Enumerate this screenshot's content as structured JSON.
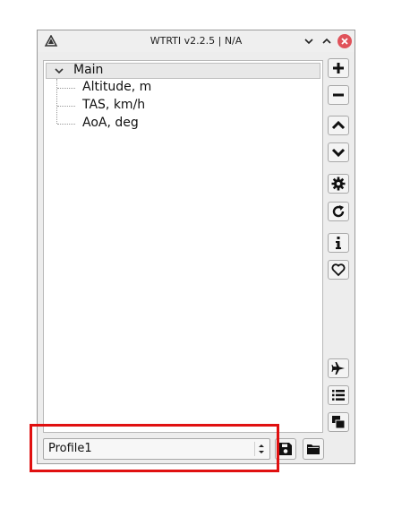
{
  "window": {
    "title": "WTRTI v2.2.5 | N/A",
    "icon": "app-logo-icon"
  },
  "titlebar_buttons": [
    "minimize-chevron-icon",
    "maximize-chevron-icon",
    "close-icon"
  ],
  "tree": {
    "root": {
      "label": "Main",
      "expanded": true
    },
    "items": [
      {
        "label": "Altitude, m"
      },
      {
        "label": "TAS, km/h"
      },
      {
        "label": "AoA, deg"
      }
    ]
  },
  "sidebar_buttons": [
    "plus-icon",
    "minus-icon",
    "chevron-up-icon",
    "chevron-down-icon",
    "gear-icon",
    "refresh-icon",
    "info-icon",
    "heart-icon",
    "airplane-icon",
    "list-icon",
    "window-icon"
  ],
  "profile": {
    "selected": "Profile1"
  },
  "bottom_buttons": [
    "save-icon",
    "folder-icon"
  ],
  "colors": {
    "highlight": "#e01010",
    "close_button": "#e0525a"
  }
}
